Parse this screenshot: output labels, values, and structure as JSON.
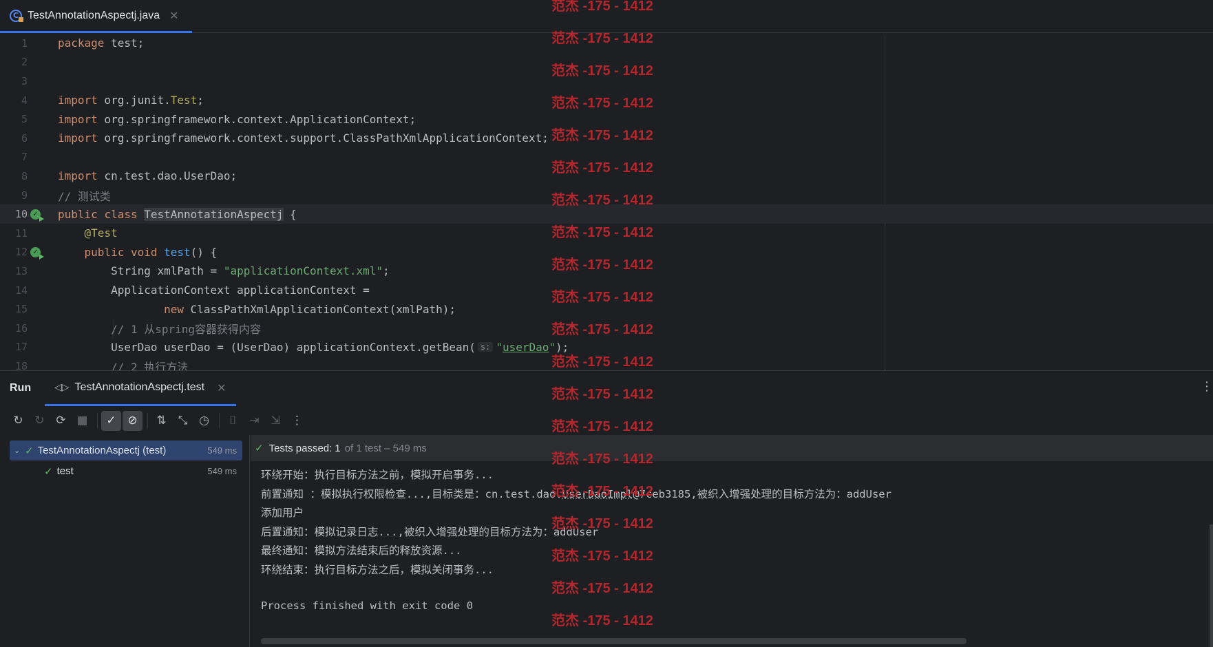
{
  "editor_tab": {
    "filename": "TestAnnotationAspectj.java",
    "close": "✕"
  },
  "code": {
    "line_numbers": [
      "1",
      "2",
      "3",
      "4",
      "5",
      "6",
      "7",
      "8",
      "9",
      "10",
      "11",
      "12",
      "13",
      "14",
      "15",
      "16",
      "17",
      "18"
    ],
    "l1": {
      "kw": "package",
      "rest": " test;"
    },
    "l4": {
      "kw": "import",
      "pre": " org.junit.",
      "cls": "Test",
      "post": ";"
    },
    "l5": {
      "kw": "import",
      "rest": " org.springframework.context.ApplicationContext;"
    },
    "l6": {
      "kw": "import",
      "rest": " org.springframework.context.support.ClassPathXmlApplicationContext;"
    },
    "l8": {
      "kw": "import",
      "rest": " cn.test.dao.UserDao;"
    },
    "l9": {
      "comment": "// 测试类"
    },
    "l10": {
      "kw1": "public",
      "kw2": "class",
      "name": "TestAnnotationAspectj",
      "rest": " {"
    },
    "l11": {
      "ann": "@Test"
    },
    "l12": {
      "kw1": "public",
      "kw2": "void",
      "fn": "test",
      "rest": "() {"
    },
    "l13": {
      "pre": "String xmlPath = ",
      "str": "\"applicationContext.xml\"",
      "post": ";"
    },
    "l14": {
      "text": "ApplicationContext applicationContext ="
    },
    "l15": {
      "kw": "new",
      "rest": " ClassPathXmlApplicationContext(xmlPath);"
    },
    "l16": {
      "comment": "// 1 从spring容器获得内容"
    },
    "l17": {
      "pre": "UserDao userDao = (UserDao) applicationContext.getBean(",
      "hint": "s:",
      "q1": "\"",
      "str": "userDao",
      "q2": "\"",
      "post": ");"
    },
    "l18": {
      "comment": "// 2 执行方法"
    }
  },
  "run_panel": {
    "title": "Run",
    "tab_label": "TestAnnotationAspectj.test",
    "tab_icon": "◁▷",
    "tab_close": "✕",
    "more": "⋮",
    "toolbar": {
      "rerun": "↻",
      "rerun_failed": "↻",
      "toggle_auto": "⟳",
      "stop": "■",
      "show_passed": "✓",
      "show_ignored": "⊘",
      "sort": "⇅",
      "collapse": "⤡",
      "history": "◷",
      "screenshot": "⌷",
      "import": "⇥",
      "export": "⇲",
      "more": "⋮"
    },
    "tree": [
      {
        "label": "TestAnnotationAspectj (test)",
        "duration": "549 ms"
      },
      {
        "label": "test",
        "duration": "549 ms"
      }
    ],
    "status": {
      "main": "Tests passed:",
      "count": "1",
      "sub": "of 1 test – 549 ms"
    },
    "console": [
      "环绕开始：执行目标方法之前，模拟开启事务...",
      "前置通知 ：模拟执行权限检查...,目标类是：cn.test.dao.",
      "UserDaoImpl",
      "@7ceb3185,被织入增强处理的目标方法为：addUser",
      "添加用户",
      "后置通知：模拟记录日志...,被织入增强处理的目标方法为：addUser",
      "最终通知：模拟方法结束后的释放资源...",
      "环绕结束：执行目标方法之后，模拟关闭事务...",
      "Process finished with exit code 0"
    ]
  },
  "watermark": "范杰 -175 - 1412",
  "colors": {
    "accent": "#3574f0",
    "pass": "#5fb865",
    "watermark": "#b5272d"
  }
}
